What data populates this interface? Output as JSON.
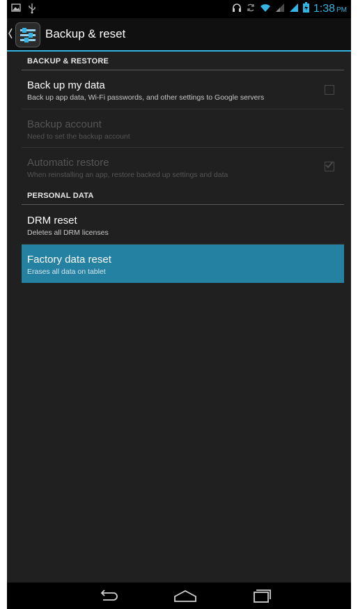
{
  "status_bar": {
    "time": "1:38",
    "ampm": "PM",
    "left_icons": [
      "image-icon",
      "usb-icon"
    ],
    "right_icons": [
      "headset-icon",
      "sync-icon",
      "wifi-icon",
      "signal-icon",
      "signal-icon",
      "battery-icon"
    ]
  },
  "action_bar": {
    "title": "Backup & reset",
    "app_icon": "settings-sliders-icon"
  },
  "sections": {
    "backup_restore": "BACKUP & RESTORE",
    "personal_data": "PERSONAL DATA"
  },
  "settings": [
    {
      "title": "Back up my data",
      "summary": "Back up app data, Wi-Fi passwords, and other settings to Google servers",
      "enabled": true,
      "checked": false
    },
    {
      "title": "Backup account",
      "summary": "Need to set the backup account",
      "enabled": false
    },
    {
      "title": "Automatic restore",
      "summary": "When reinstalling an app, restore backed up settings and data",
      "enabled": false,
      "checked": true
    },
    {
      "title": "DRM reset",
      "summary": "Deletes all DRM licenses",
      "enabled": true
    },
    {
      "title": "Factory data reset",
      "summary": "Erases all data on tablet",
      "enabled": true,
      "selected": true
    }
  ],
  "nav_bar": [
    "back-icon",
    "home-icon",
    "recent-apps-icon"
  ],
  "colors": {
    "accent": "#33b5e5",
    "selected_row": "#2581a2",
    "background": "#202020"
  }
}
